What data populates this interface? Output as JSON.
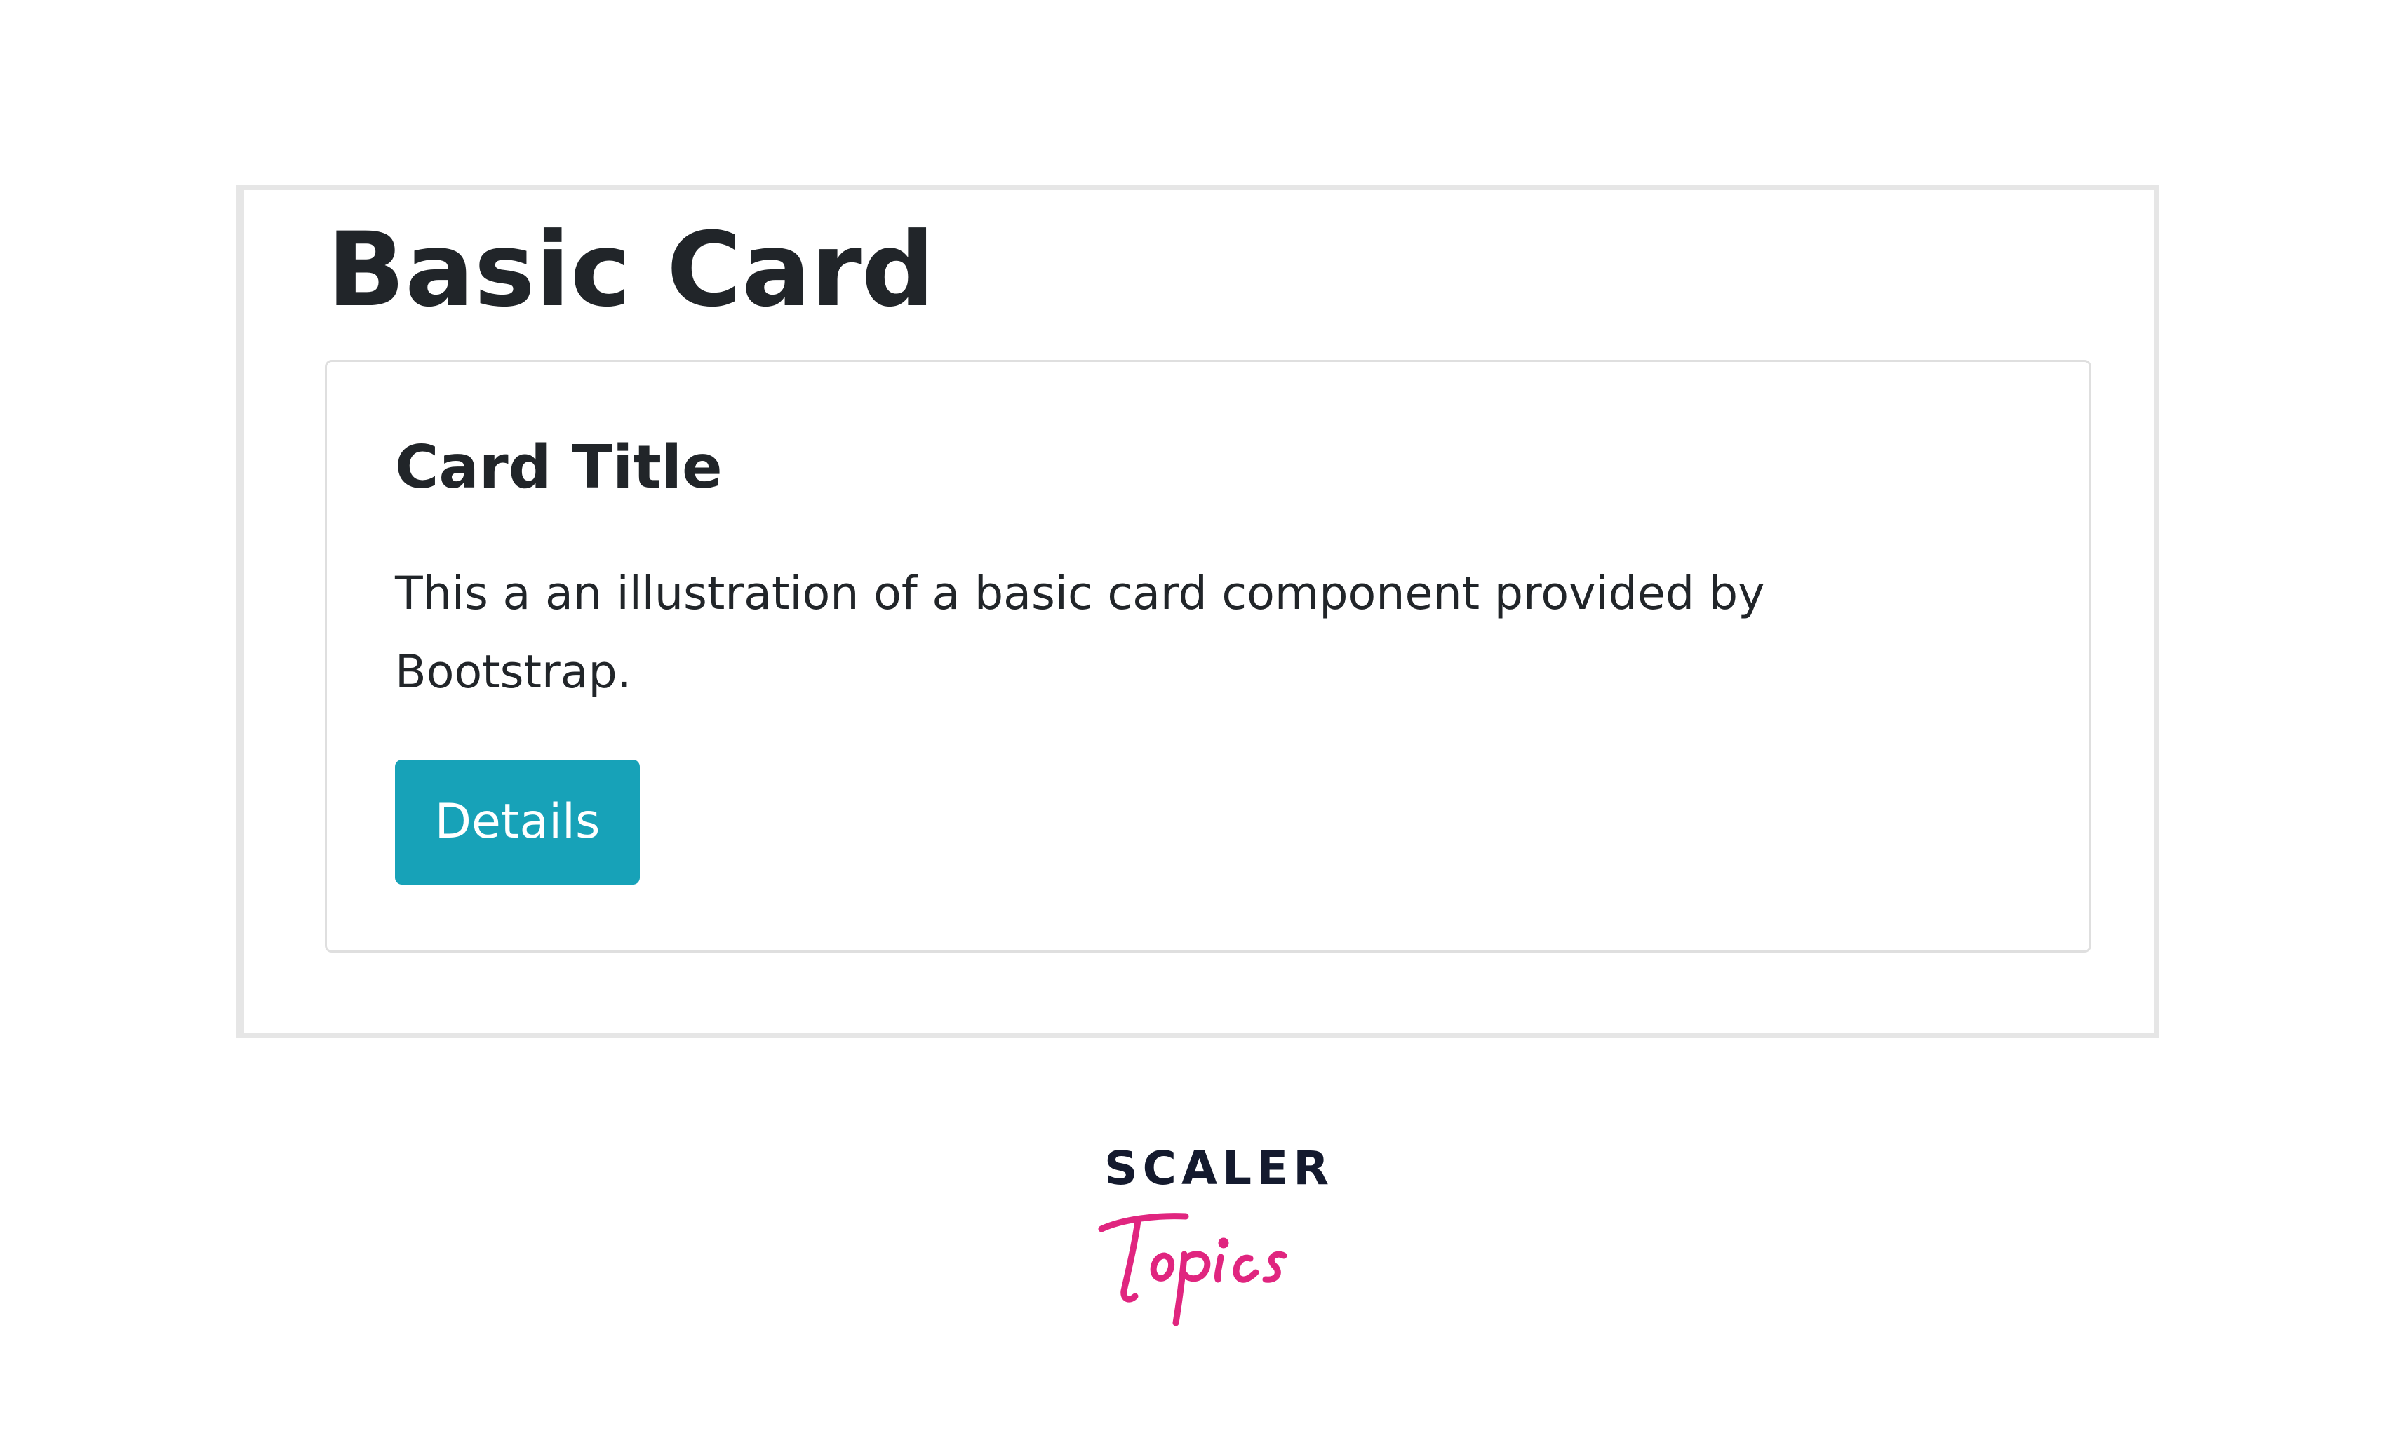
{
  "page": {
    "heading": "Basic Card"
  },
  "card": {
    "title": "Card Title",
    "text": "This a an illustration of a basic card component provided by Bootstrap.",
    "button_label": "Details"
  },
  "logo": {
    "wordmark": "SCALER",
    "script_text": "Topics"
  },
  "colors": {
    "button_bg": "#17a2b8",
    "text": "#212529",
    "logo_dark": "#141a2e",
    "logo_accent": "#e0257f",
    "frame_border": "#e6e6e6",
    "card_border": "#dfdfdf"
  }
}
